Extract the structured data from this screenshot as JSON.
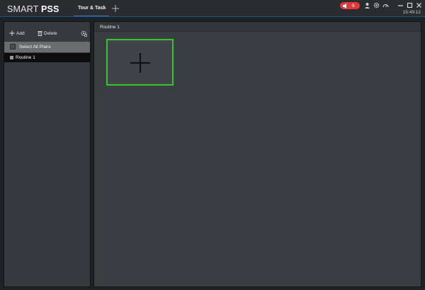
{
  "app": {
    "logo_light": "SMART ",
    "logo_bold": "PSS"
  },
  "tabs": {
    "active_label": "Tour & Task"
  },
  "titlebar": {
    "alarm_count": "6",
    "clock": "15:49:12"
  },
  "left_panel": {
    "add_label": "Add",
    "delete_label": "Delete",
    "select_all_label": "Select All Plans",
    "plans": [
      {
        "label": "Routine 1"
      }
    ]
  },
  "right_panel": {
    "routine_title": "Routine 1"
  },
  "colors": {
    "accent_blue": "#2f79c7",
    "alarm_red": "#e0393b",
    "selection_green": "#33c533"
  }
}
